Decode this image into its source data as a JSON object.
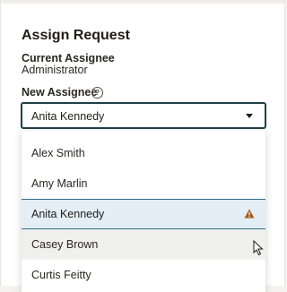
{
  "dialog": {
    "title": "Assign Request",
    "current_assignee_label": "Current Assignee",
    "current_assignee_value": "Administrator",
    "new_assignee_label": "New Assignee",
    "help_icon": "question-circle-icon"
  },
  "assignee_select": {
    "value": "Anita Kennedy",
    "icon": "chevron-down-icon",
    "options": [
      {
        "label": "Alex Smith"
      },
      {
        "label": "Amy Marlin"
      },
      {
        "label": "Anita Kennedy",
        "selected": true,
        "warning_icon": "warning-triangle-icon"
      },
      {
        "label": "Casey Brown",
        "hovered": true
      },
      {
        "label": "Curtis Feitty"
      }
    ]
  },
  "colors": {
    "accent_border": "#1f3f47",
    "selected_bg": "#e4eef5",
    "selected_border": "#2f6d87",
    "warning": "#a85a1a"
  }
}
